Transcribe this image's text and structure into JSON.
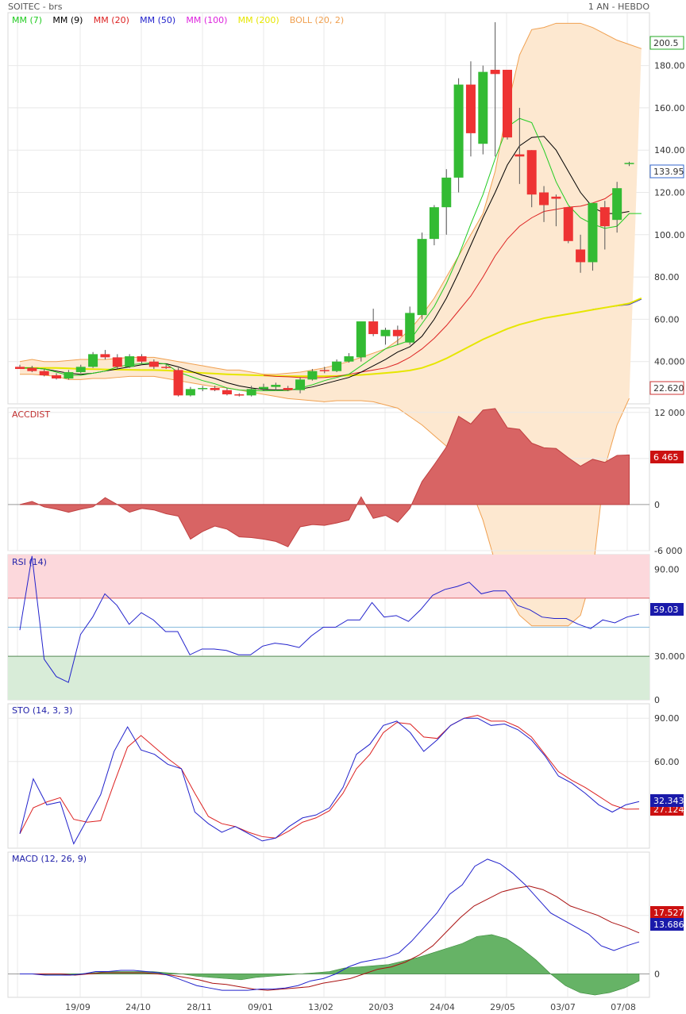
{
  "header": {
    "ticker": "SOITEC - brs",
    "period": "1 AN - HEBDO"
  },
  "legend": [
    {
      "label": "MM (7)",
      "color": "#22cc22"
    },
    {
      "label": "MM (9)",
      "color": "#000000"
    },
    {
      "label": "MM (20)",
      "color": "#dd2222"
    },
    {
      "label": "MM (50)",
      "color": "#2222cc"
    },
    {
      "label": "MM (100)",
      "color": "#dd22dd"
    },
    {
      "label": "MM (200)",
      "color": "#e6e600"
    },
    {
      "label": "BOLL (20, 2)",
      "color": "#f0a050"
    }
  ],
  "colors": {
    "up": "#33bb33",
    "down": "#ee3333",
    "boll_fill": "#fde8d0",
    "boll_line": "#f0a050",
    "accdist": "#d86464",
    "rsi": "#2222cc",
    "sto_k": "#2222cc",
    "sto_d": "#dd2222",
    "macd_hist": "#66b366"
  },
  "chart_data": [
    {
      "type": "candlestick",
      "title": "SOITEC - brs",
      "x_ticks": [
        "19/09",
        "24/10",
        "28/11",
        "09/01",
        "13/02",
        "20/03",
        "24/04",
        "29/05",
        "03/07",
        "07/08"
      ],
      "y_ticks": [
        "180.00",
        "160.00",
        "140.00",
        "120.00",
        "100.00",
        "80.00",
        "60.00",
        "40.000"
      ],
      "ylim": [
        20,
        205
      ],
      "last_labels": {
        "high": "200.5",
        "close": "133.95",
        "low": "22.620"
      },
      "candles": [
        {
          "o": 37.5,
          "h": 38.5,
          "l": 36.5,
          "c": 36.5
        },
        {
          "o": 37,
          "h": 38,
          "l": 35,
          "c": 35.5
        },
        {
          "o": 35.5,
          "h": 36.5,
          "l": 33,
          "c": 33.5
        },
        {
          "o": 33.5,
          "h": 34.5,
          "l": 31.5,
          "c": 32
        },
        {
          "o": 32,
          "h": 36,
          "l": 31.5,
          "c": 35
        },
        {
          "o": 35,
          "h": 38.5,
          "l": 34.5,
          "c": 37.5
        },
        {
          "o": 37.5,
          "h": 44.5,
          "l": 37,
          "c": 43.5
        },
        {
          "o": 43.5,
          "h": 45.5,
          "l": 41,
          "c": 42
        },
        {
          "o": 42,
          "h": 43.5,
          "l": 36.5,
          "c": 37.5
        },
        {
          "o": 37.5,
          "h": 43.5,
          "l": 37,
          "c": 42.5
        },
        {
          "o": 42.5,
          "h": 43.5,
          "l": 39,
          "c": 40
        },
        {
          "o": 40,
          "h": 41,
          "l": 36.5,
          "c": 37.5
        },
        {
          "o": 37.5,
          "h": 38.5,
          "l": 36.5,
          "c": 37
        },
        {
          "o": 36,
          "h": 37,
          "l": 23.5,
          "c": 24
        },
        {
          "o": 24,
          "h": 28,
          "l": 23.5,
          "c": 27
        },
        {
          "o": 27,
          "h": 28.5,
          "l": 26,
          "c": 27.5
        },
        {
          "o": 27.5,
          "h": 28.5,
          "l": 26,
          "c": 26.5
        },
        {
          "o": 26.5,
          "h": 27.5,
          "l": 24,
          "c": 24.5
        },
        {
          "o": 24.5,
          "h": 25,
          "l": 23.5,
          "c": 24
        },
        {
          "o": 24,
          "h": 28.5,
          "l": 23.5,
          "c": 27
        },
        {
          "o": 27,
          "h": 29.5,
          "l": 26,
          "c": 28
        },
        {
          "o": 28,
          "h": 30,
          "l": 26.5,
          "c": 29
        },
        {
          "o": 27.5,
          "h": 28.5,
          "l": 26,
          "c": 26.5
        },
        {
          "o": 26.5,
          "h": 32.5,
          "l": 25,
          "c": 31.5
        },
        {
          "o": 31.5,
          "h": 36.5,
          "l": 31,
          "c": 35.5
        },
        {
          "o": 36,
          "h": 37.5,
          "l": 34.5,
          "c": 35.5
        },
        {
          "o": 35.5,
          "h": 41,
          "l": 35,
          "c": 40
        },
        {
          "o": 40,
          "h": 44,
          "l": 39.5,
          "c": 42.5
        },
        {
          "o": 42,
          "h": 57,
          "l": 40,
          "c": 59
        },
        {
          "o": 59,
          "h": 65,
          "l": 52,
          "c": 53
        },
        {
          "o": 52,
          "h": 56,
          "l": 48,
          "c": 55
        },
        {
          "o": 55,
          "h": 57,
          "l": 48,
          "c": 52
        },
        {
          "o": 49,
          "h": 66,
          "l": 48,
          "c": 63
        },
        {
          "o": 62,
          "h": 101,
          "l": 60,
          "c": 98
        },
        {
          "o": 98,
          "h": 114,
          "l": 95,
          "c": 113
        },
        {
          "o": 113,
          "h": 131,
          "l": 100,
          "c": 127
        },
        {
          "o": 127,
          "h": 174,
          "l": 120,
          "c": 171
        },
        {
          "o": 171,
          "h": 182,
          "l": 137,
          "c": 148
        },
        {
          "o": 143,
          "h": 180,
          "l": 138,
          "c": 177
        },
        {
          "o": 178,
          "h": 200.5,
          "l": 137,
          "c": 176
        },
        {
          "o": 178,
          "h": 178,
          "l": 145,
          "c": 146
        },
        {
          "o": 138,
          "h": 160,
          "l": 124,
          "c": 137
        },
        {
          "o": 140,
          "h": 140,
          "l": 113,
          "c": 119
        },
        {
          "o": 120,
          "h": 123,
          "l": 106,
          "c": 114
        },
        {
          "o": 118,
          "h": 119,
          "l": 104,
          "c": 117
        },
        {
          "o": 113,
          "h": 113,
          "l": 96,
          "c": 97
        },
        {
          "o": 93,
          "h": 100,
          "l": 82,
          "c": 87
        },
        {
          "o": 87,
          "h": 115,
          "l": 83,
          "c": 115
        },
        {
          "o": 113,
          "h": 116,
          "l": 93,
          "c": 104
        },
        {
          "o": 107,
          "h": 125,
          "l": 101,
          "c": 122
        },
        {
          "o": 133.5,
          "h": 134.5,
          "l": 132.5,
          "c": 133.95
        }
      ],
      "series": [
        {
          "values": [
            37,
            37,
            36.5,
            35,
            33.5,
            33.5,
            34.5,
            35.5,
            37.5,
            38.5,
            39,
            39.5,
            38.8,
            35,
            33,
            31,
            29.5,
            27.5,
            26.5,
            26.3,
            26.2,
            26.3,
            26.3,
            27.5,
            29,
            31,
            32.5,
            34,
            38,
            42,
            46,
            48,
            50,
            58,
            66,
            77,
            90,
            105,
            119,
            136,
            151,
            155,
            153,
            140,
            125,
            114,
            108,
            105,
            103,
            104,
            110,
            110
          ]
        },
        {
          "values": [
            37,
            37,
            36.5,
            35.5,
            34.5,
            34,
            34.5,
            35.5,
            36.5,
            37.5,
            38.5,
            39,
            39,
            37.5,
            35.5,
            33.5,
            32,
            30,
            28.5,
            27.5,
            26.8,
            26.6,
            26.6,
            27,
            28,
            29.5,
            31,
            32.5,
            35,
            38,
            41,
            44.5,
            47,
            52,
            60,
            70,
            82,
            95,
            108,
            120,
            133,
            142,
            146,
            146.5,
            140,
            130,
            120,
            113,
            110,
            110,
            111
          ]
        },
        {
          "values": [
            null,
            null,
            null,
            null,
            null,
            null,
            null,
            null,
            null,
            null,
            null,
            null,
            null,
            null,
            null,
            null,
            null,
            null,
            null,
            null,
            33.5,
            33,
            32.8,
            32.5,
            32.3,
            32.5,
            33,
            34,
            35,
            36,
            37,
            39,
            42,
            46,
            51,
            57,
            64,
            71,
            80,
            90,
            98,
            104,
            108,
            111,
            112,
            113,
            113.5,
            115,
            117,
            121
          ]
        },
        {
          "values": [
            37,
            37,
            37,
            37,
            36.8,
            36.5,
            36.4,
            36.3,
            36.2,
            36.1,
            36,
            36,
            35.8,
            35.5,
            35,
            34.6,
            34.3,
            34,
            33.8,
            33.6,
            33.4,
            33.2,
            33.1,
            33.1,
            33.1,
            33.1,
            33.2,
            33.4,
            33.7,
            34.1,
            34.6,
            35.1,
            35.8,
            37,
            39,
            41.5,
            44.5,
            47.5,
            50.5,
            53,
            55.5,
            57.5,
            59,
            60.5,
            61.5,
            62.5,
            63.5,
            64.5,
            65.5,
            66.5,
            67.5,
            70
          ]
        },
        {
          "values": [
            37,
            37,
            37,
            37,
            36.8,
            36.5,
            36.4,
            36.3,
            36.2,
            36.1,
            36,
            36,
            35.8,
            35.5,
            35,
            34.6,
            34.3,
            34,
            33.8,
            33.6,
            33.4,
            33.2,
            33.1,
            33.1,
            33.1,
            33.1,
            33.2,
            33.4,
            33.7,
            34.1,
            34.6,
            35.1,
            35.8,
            37,
            39,
            41.5,
            44.5,
            47.5,
            50.5,
            53,
            55.5,
            57.5,
            59,
            60,
            61,
            61.8,
            62.5,
            63.2,
            64,
            64.8,
            65.5,
            68
          ]
        },
        {
          "values": [
            40,
            41,
            40,
            40,
            40.5,
            41,
            41,
            41,
            41.5,
            42,
            42,
            42,
            41,
            40,
            39,
            38,
            37,
            36,
            36,
            35,
            34,
            34,
            34.5,
            35,
            36,
            37,
            38.5,
            40,
            42,
            44,
            46,
            50,
            55,
            62,
            70,
            80,
            90,
            100,
            110,
            130,
            160,
            185,
            197,
            198,
            200,
            200,
            200,
            198,
            195,
            192,
            190,
            188
          ]
        },
        {
          "values": [
            34,
            34,
            33.5,
            33,
            31.5,
            31.5,
            32,
            32,
            32.5,
            33,
            33,
            33,
            32,
            31,
            30,
            29,
            28,
            27.5,
            26.5,
            25.5,
            24.5,
            23.5,
            22.5,
            22,
            21.5,
            21,
            21.5,
            21.5,
            21.5,
            21,
            19.5,
            18,
            14,
            10,
            5,
            0,
            -10,
            -20,
            -35,
            -55,
            -70,
            -80,
            -85,
            -85,
            -85,
            -85,
            -80,
            -60,
            -10,
            10,
            22.6
          ]
        }
      ]
    },
    {
      "type": "area",
      "title": "ACCDIST",
      "y_ticks": [
        "12 000",
        "6 000",
        "0",
        "-6 000"
      ],
      "ylim": [
        -6000,
        12600
      ],
      "last_label": "6 465",
      "values": [
        0,
        400,
        -300,
        -600,
        -1000,
        -600,
        -300,
        900,
        0,
        -1000,
        -500,
        -700,
        -1200,
        -1500,
        -4500,
        -3500,
        -2800,
        -3200,
        -4200,
        -4300,
        -4500,
        -4800,
        -5500,
        -2900,
        -2600,
        -2700,
        -2400,
        -2000,
        1000,
        -1800,
        -1400,
        -2300,
        -500,
        3000,
        5200,
        7500,
        11500,
        10500,
        12300,
        12500,
        10000,
        9800,
        8000,
        7400,
        7300,
        6100,
        5000,
        5900,
        5500,
        6400,
        6465
      ]
    },
    {
      "type": "line",
      "title": "RSI (14)",
      "y_ticks": [
        "90.00",
        "59.03",
        "30.000",
        "0"
      ],
      "ylim": [
        0,
        100
      ],
      "overbought": 70,
      "oversold": 30,
      "last_label": "59.03",
      "values": [
        48,
        99,
        28,
        16,
        12,
        45,
        57,
        73,
        65,
        52,
        60,
        55,
        47,
        47,
        31,
        35,
        35,
        34,
        31,
        31,
        37,
        39,
        38,
        36,
        44,
        50,
        50,
        55,
        55,
        67,
        57,
        58,
        54,
        62,
        72,
        76,
        78,
        81,
        73,
        75,
        75,
        65,
        62,
        57,
        56,
        56,
        52,
        49,
        55,
        53,
        57,
        59
      ]
    },
    {
      "type": "line",
      "title": "STO (14, 3, 3)",
      "y_ticks": [
        "90.00",
        "60.00",
        "27.124",
        "32.343"
      ],
      "ylim": [
        0,
        100
      ],
      "last_labels": {
        "k": "32.343",
        "d": "27.124"
      },
      "series": [
        {
          "name": "K",
          "values": [
            10,
            48,
            30,
            32,
            3,
            20,
            37,
            67,
            84,
            68,
            65,
            58,
            55,
            25,
            17,
            11,
            15,
            10,
            5,
            7,
            15,
            21,
            23,
            28,
            42,
            65,
            72,
            85,
            88,
            80,
            67,
            75,
            85,
            90,
            90,
            85,
            86,
            82,
            75,
            64,
            50,
            45,
            38,
            30,
            25,
            30,
            32.3
          ]
        },
        {
          "name": "D",
          "values": [
            10,
            28,
            32,
            35,
            20,
            18,
            19,
            45,
            70,
            78,
            70,
            62,
            55,
            38,
            22,
            17,
            15,
            11,
            8,
            7,
            12,
            18,
            21,
            26,
            38,
            55,
            65,
            80,
            87,
            86,
            77,
            76,
            85,
            90,
            92,
            88,
            88,
            84,
            77,
            65,
            53,
            47,
            42,
            36,
            30,
            27,
            27.1
          ]
        }
      ]
    },
    {
      "type": "bar",
      "title": "MACD (12, 26, 9)",
      "y_ticks": [
        "17.527",
        "13.686",
        "0"
      ],
      "ylim": [
        -10,
        52
      ],
      "last_labels": {
        "signal": "17.527",
        "macd": "13.686"
      },
      "series": [
        {
          "name": "MACD",
          "values": [
            0,
            0,
            -0.5,
            -0.5,
            -0.5,
            0,
            1,
            1,
            1.5,
            1.5,
            1,
            0.5,
            -1,
            -3,
            -5,
            -6,
            -7,
            -7,
            -7,
            -6.5,
            -6.5,
            -6,
            -5,
            -3,
            -2,
            0,
            3,
            5,
            6,
            7,
            9,
            14,
            20,
            26,
            34,
            38,
            46,
            49,
            47,
            43,
            38,
            32,
            26,
            23,
            20,
            17,
            12,
            10,
            12,
            13.7
          ]
        },
        {
          "name": "Signal",
          "values": [
            0,
            0,
            0,
            0,
            -0.5,
            0,
            0.5,
            0.5,
            0.5,
            0.5,
            0,
            -0.5,
            -1.5,
            -2.5,
            -4,
            -4.5,
            -5.5,
            -6.5,
            -7,
            -6.5,
            -6,
            -5.5,
            -4,
            -3,
            -2,
            0,
            2,
            3,
            5,
            8,
            12,
            18,
            24,
            29,
            32,
            35,
            36.5,
            37.5,
            36,
            33,
            29,
            27,
            25,
            22,
            20,
            17.5
          ]
        },
        {
          "name": "Hist",
          "values": [
            0,
            0,
            -0.5,
            -0.5,
            0,
            0.5,
            1,
            1,
            1,
            1,
            0.5,
            0,
            -1,
            -1.5,
            -2,
            -2.5,
            -1.5,
            -1,
            -0.5,
            0,
            0.5,
            1,
            2.5,
            3,
            3.5,
            4,
            5.5,
            7,
            9,
            11,
            13,
            16,
            16.8,
            15,
            11,
            6,
            0,
            -5,
            -8,
            -9,
            -8,
            -6,
            -3
          ]
        }
      ]
    }
  ]
}
